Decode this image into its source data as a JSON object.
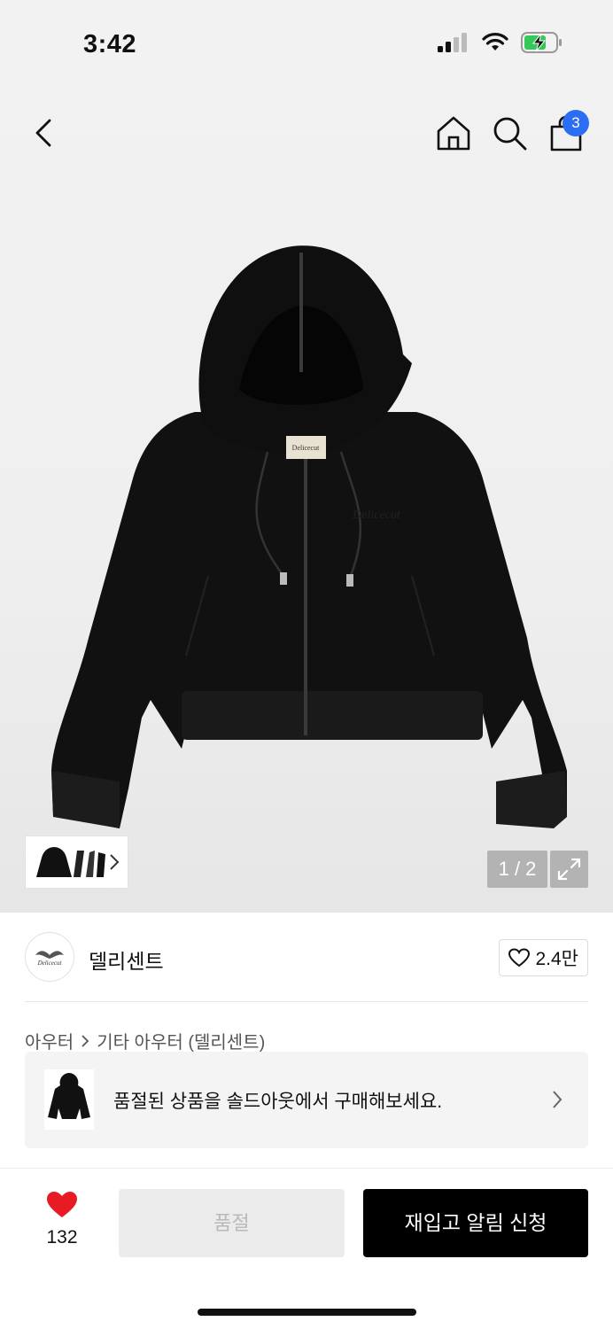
{
  "status_bar": {
    "time": "3:42"
  },
  "nav": {
    "cart_count": "3",
    "accent_color": "#2b6df3"
  },
  "gallery": {
    "pager": "1 / 2",
    "logo_text": "Delicecut"
  },
  "brand": {
    "name": "델리센트",
    "likes": "2.4만"
  },
  "breadcrumb": {
    "level1": "아우터",
    "level2": "기타 아우터 (델리센트)"
  },
  "promo": {
    "text": "품절된 상품을 솔드아웃에서 구매해보세요."
  },
  "bottom_bar": {
    "wish_count": "132",
    "soldout_label": "품절",
    "restock_label": "재입고 알림 신청"
  }
}
